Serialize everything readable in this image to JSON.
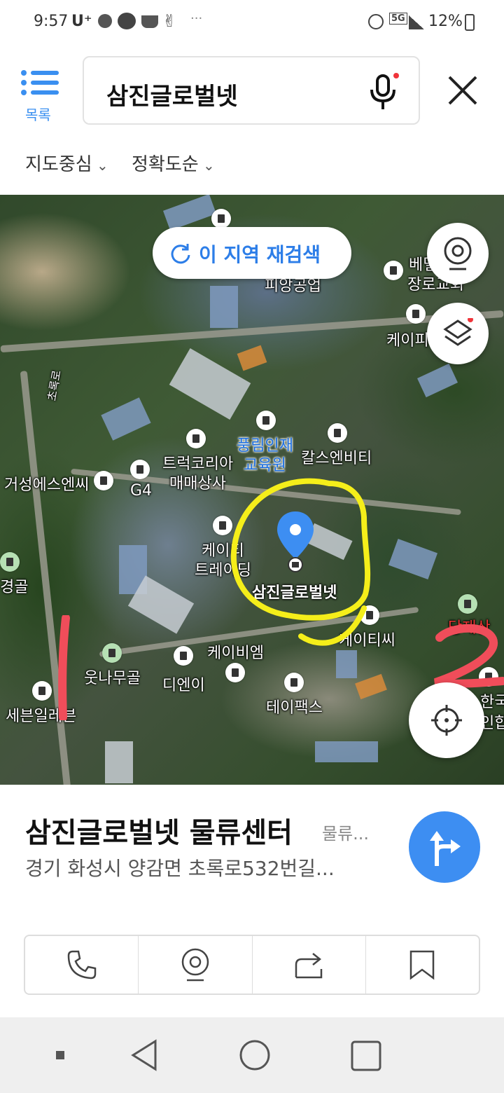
{
  "status_bar": {
    "time": "9:57",
    "carrier": "U⁺",
    "app_icons": [
      "facebook-icon",
      "tmon-icon",
      "cup-icon",
      "victory-hand-icon"
    ],
    "more": "···",
    "network": "5G",
    "battery": "12%"
  },
  "header": {
    "menu_label": "목록",
    "search_text": "삼진글로벌넷"
  },
  "filters": [
    {
      "label": "지도중심"
    },
    {
      "label": "정확도순"
    }
  ],
  "map": {
    "reload_label": "이 지역 재검색",
    "labels": {
      "pungnim": "풍림인재",
      "education": "교육원",
      "kalsu": "칼스엔비티",
      "truck": "트럭코리아",
      "maemae": "매매상사",
      "geoseong": "거성에스엔씨",
      "g4": "G4",
      "keiti": "케이티",
      "trading": "트레이딩",
      "target": "삼진글로벌넷",
      "keitissi": "케이티씨",
      "keibiem": "케이비엠",
      "dienei": "디엔이",
      "unnamu": "웃나무골",
      "seven": "세븐일레븐",
      "taipaks": "테이팩스",
      "gyeonggol": "경골",
      "pyeonggong": "피앙공업",
      "bethel": "베델",
      "jangro": "장로교회",
      "keipi": "케이피",
      "dangjae": "당재산",
      "hanguk": "한국",
      "inhap": "인합",
      "chorok": "초록로"
    },
    "annotations": [
      "1",
      "2"
    ],
    "colors": {
      "annotation_red": "#f04d5a",
      "annotation_yellow": "#f5ee1a",
      "marker_blue": "#3d8ef2"
    }
  },
  "place": {
    "name": "삼진글로벌넷 물류센터",
    "category": "물류...",
    "address": "경기 화성시 양감면 초록로532번길..."
  },
  "actions": [
    "phone-icon",
    "roadview-icon",
    "share-icon",
    "bookmark-icon"
  ]
}
